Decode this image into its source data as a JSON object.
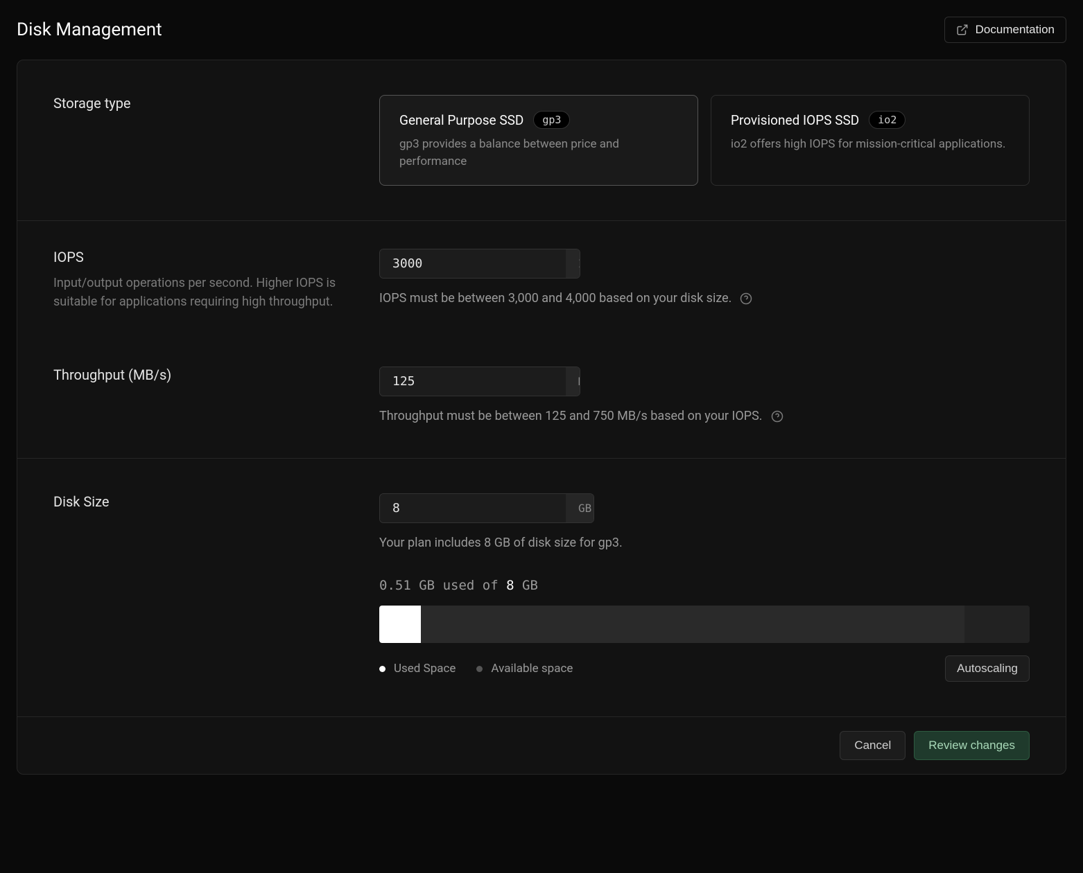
{
  "header": {
    "title": "Disk Management",
    "documentation_label": "Documentation"
  },
  "storage_type": {
    "label": "Storage type",
    "options": [
      {
        "title": "General Purpose SSD",
        "badge": "gp3",
        "desc": "gp3 provides a balance between price and performance",
        "selected": true
      },
      {
        "title": "Provisioned IOPS SSD",
        "badge": "io2",
        "desc": "io2 offers high IOPS for mission-critical applications.",
        "selected": false
      }
    ]
  },
  "iops": {
    "label": "IOPS",
    "desc": "Input/output operations per second. Higher IOPS is suitable for applications requiring high throughput.",
    "value": "3000",
    "unit": "IOPS",
    "hint": "IOPS must be between 3,000 and 4,000 based on your disk size."
  },
  "throughput": {
    "label": "Throughput (MB/s)",
    "value": "125",
    "unit": "MB/s",
    "hint": "Throughput must be between 125 and 750 MB/s based on your IOPS."
  },
  "disk_size": {
    "label": "Disk Size",
    "value": "8",
    "unit": "GB",
    "hint": "Your plan includes 8 GB of disk size for gp3.",
    "used": "0.51",
    "used_unit": "GB",
    "used_of_label": "used of",
    "total": "8",
    "total_unit": "GB",
    "legend_used": "Used Space",
    "legend_available": "Available space",
    "autoscaling_label": "Autoscaling"
  },
  "footer": {
    "cancel": "Cancel",
    "review": "Review changes"
  }
}
